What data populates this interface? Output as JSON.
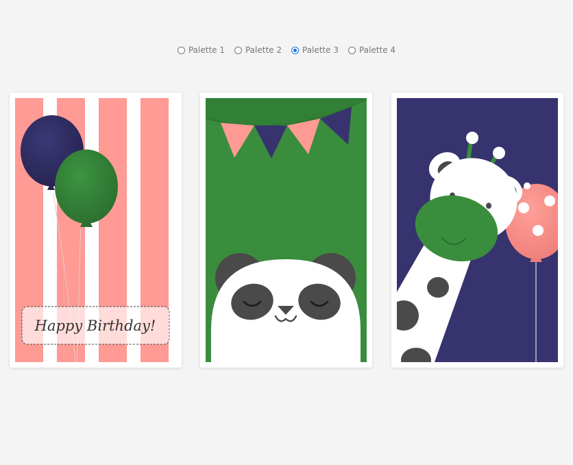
{
  "palette_options": [
    {
      "label": "Palette 1",
      "checked": false
    },
    {
      "label": "Palette 2",
      "checked": false
    },
    {
      "label": "Palette 3",
      "checked": true
    },
    {
      "label": "Palette 4",
      "checked": false
    }
  ],
  "cards": {
    "birthday": {
      "message": "Happy Birthday!"
    }
  },
  "colors": {
    "salmon": "#ff9a94",
    "navy": "#37336f",
    "green": "#3a8d3d",
    "gray": "#4a4a4a",
    "accent": "#1a73e8"
  }
}
